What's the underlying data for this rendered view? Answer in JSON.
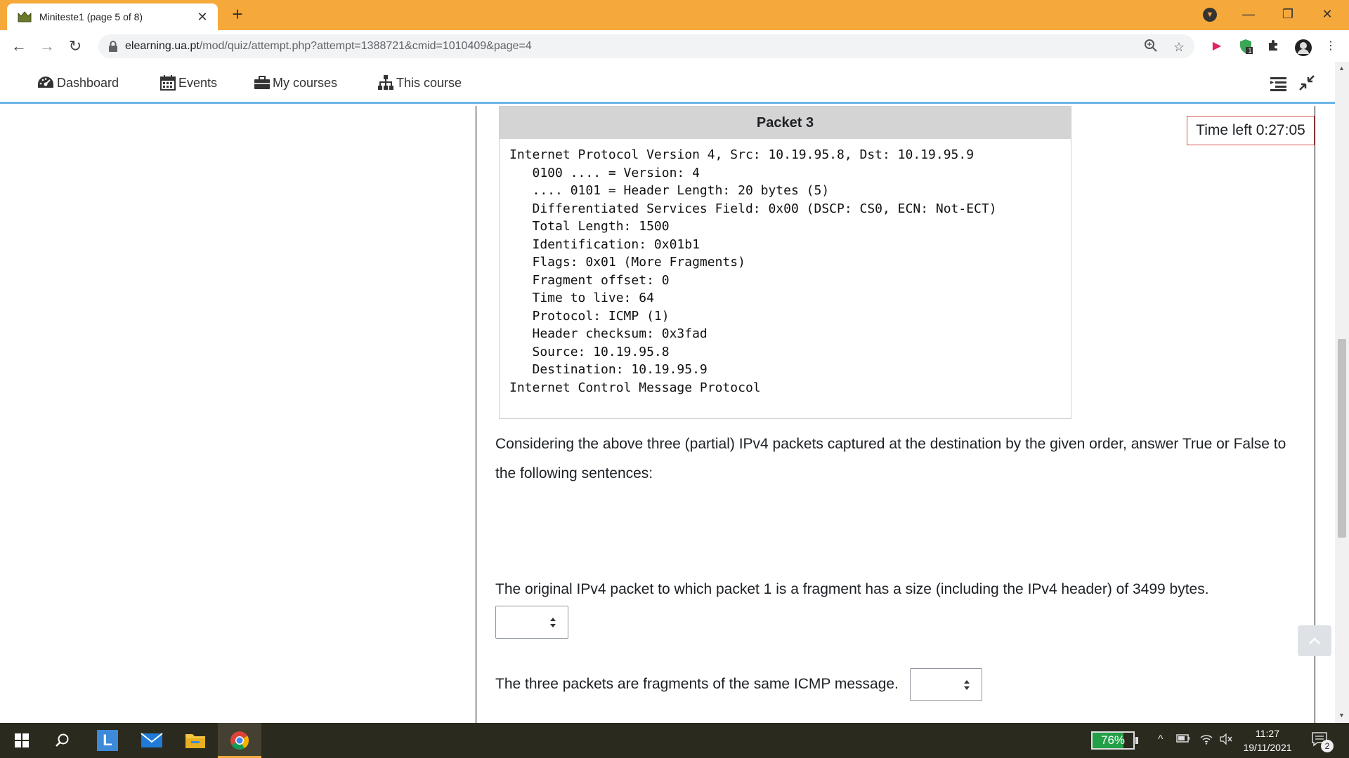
{
  "browser": {
    "tab_title": "Miniteste1 (page 5 of 8)",
    "url_host": "elearning.ua.pt",
    "url_path": "/mod/quiz/attempt.php?attempt=1388721&cmid=1010409&page=4",
    "extension_badge": "1"
  },
  "navbar": {
    "items": [
      {
        "label": "Dashboard",
        "icon": "dashboard-icon"
      },
      {
        "label": "Events",
        "icon": "calendar-icon"
      },
      {
        "label": "My courses",
        "icon": "briefcase-icon"
      },
      {
        "label": "This course",
        "icon": "sitemap-icon"
      }
    ]
  },
  "timer": {
    "label": "Time left 0:27:05"
  },
  "packet": {
    "title": "Packet 3",
    "lines": [
      "Internet Protocol Version 4, Src: 10.19.95.8, Dst: 10.19.95.9",
      "   0100 .... = Version: 4",
      "   .... 0101 = Header Length: 20 bytes (5)",
      "   Differentiated Services Field: 0x00 (DSCP: CS0, ECN: Not-ECT)",
      "   Total Length: 1500",
      "   Identification: 0x01b1",
      "   Flags: 0x01 (More Fragments)",
      "   Fragment offset: 0",
      "   Time to live: 64",
      "   Protocol: ICMP (1)",
      "   Header checksum: 0x3fad",
      "   Source: 10.19.95.8",
      "   Destination: 10.19.95.9",
      "Internet Control Message Protocol"
    ]
  },
  "question": {
    "intro": "Considering the above three (partial) IPv4 packets captured at the destination by the given order, answer True or False to the following sentences:",
    "statement_1": "The original IPv4 packet to which packet 1 is a fragment has a size (including the IPv4 header) of 3499 bytes.",
    "statement_2": "The three packets are fragments of the same ICMP message."
  },
  "taskbar": {
    "battery": "76%",
    "battery_level": 0.76,
    "time": "11:27",
    "date": "19/11/2021",
    "notification_count": "2",
    "launcher_letter": "L"
  },
  "colors": {
    "chrome_accent": "#f6a93b",
    "navbar_underline": "#6bb4e6",
    "timer_border": "#d9534f",
    "taskbar": "#2b2a1f"
  }
}
